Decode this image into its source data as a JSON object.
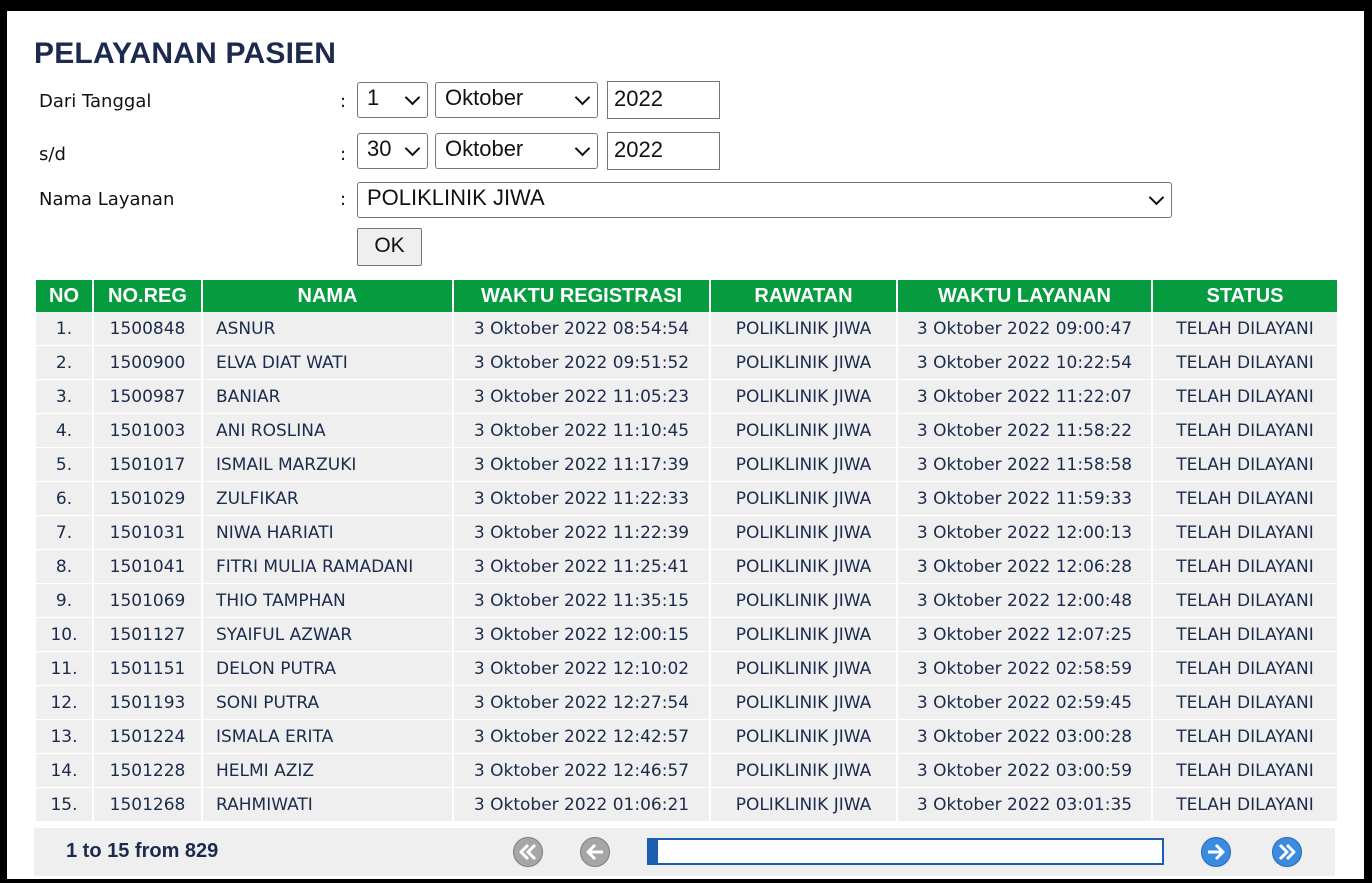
{
  "page": {
    "title": "PELAYANAN PASIEN"
  },
  "filters": {
    "from_label": "Dari Tanggal",
    "to_label": "s/d",
    "service_label": "Nama Layanan",
    "colon": ":",
    "from": {
      "day": "1",
      "month": "Oktober",
      "year": "2022"
    },
    "to": {
      "day": "30",
      "month": "Oktober",
      "year": "2022"
    },
    "service": "POLIKLINIK JIWA",
    "ok_label": "OK"
  },
  "table": {
    "columns": [
      "NO",
      "NO.REG",
      "NAMA",
      "WAKTU REGISTRASI",
      "RAWATAN",
      "WAKTU LAYANAN",
      "STATUS"
    ],
    "rows": [
      [
        "1.",
        "1500848",
        "ASNUR",
        "3 Oktober 2022 08:54:54",
        "POLIKLINIK JIWA",
        "3 Oktober 2022 09:00:47",
        "TELAH DILAYANI"
      ],
      [
        "2.",
        "1500900",
        "ELVA DIAT WATI",
        "3 Oktober 2022 09:51:52",
        "POLIKLINIK JIWA",
        "3 Oktober 2022 10:22:54",
        "TELAH DILAYANI"
      ],
      [
        "3.",
        "1500987",
        "BANIAR",
        "3 Oktober 2022 11:05:23",
        "POLIKLINIK JIWA",
        "3 Oktober 2022 11:22:07",
        "TELAH DILAYANI"
      ],
      [
        "4.",
        "1501003",
        "ANI ROSLINA",
        "3 Oktober 2022 11:10:45",
        "POLIKLINIK JIWA",
        "3 Oktober 2022 11:58:22",
        "TELAH DILAYANI"
      ],
      [
        "5.",
        "1501017",
        "ISMAIL MARZUKI",
        "3 Oktober 2022 11:17:39",
        "POLIKLINIK JIWA",
        "3 Oktober 2022 11:58:58",
        "TELAH DILAYANI"
      ],
      [
        "6.",
        "1501029",
        "ZULFIKAR",
        "3 Oktober 2022 11:22:33",
        "POLIKLINIK JIWA",
        "3 Oktober 2022 11:59:33",
        "TELAH DILAYANI"
      ],
      [
        "7.",
        "1501031",
        "NIWA HARIATI",
        "3 Oktober 2022 11:22:39",
        "POLIKLINIK JIWA",
        "3 Oktober 2022 12:00:13",
        "TELAH DILAYANI"
      ],
      [
        "8.",
        "1501041",
        "FITRI MULIA RAMADANI",
        "3 Oktober 2022 11:25:41",
        "POLIKLINIK JIWA",
        "3 Oktober 2022 12:06:28",
        "TELAH DILAYANI"
      ],
      [
        "9.",
        "1501069",
        "THIO TAMPHAN",
        "3 Oktober 2022 11:35:15",
        "POLIKLINIK JIWA",
        "3 Oktober 2022 12:00:48",
        "TELAH DILAYANI"
      ],
      [
        "10.",
        "1501127",
        "SYAIFUL AZWAR",
        "3 Oktober 2022 12:00:15",
        "POLIKLINIK JIWA",
        "3 Oktober 2022 12:07:25",
        "TELAH DILAYANI"
      ],
      [
        "11.",
        "1501151",
        "DELON PUTRA",
        "3 Oktober 2022 12:10:02",
        "POLIKLINIK JIWA",
        "3 Oktober 2022 02:58:59",
        "TELAH DILAYANI"
      ],
      [
        "12.",
        "1501193",
        "SONI PUTRA",
        "3 Oktober 2022 12:27:54",
        "POLIKLINIK JIWA",
        "3 Oktober 2022 02:59:45",
        "TELAH DILAYANI"
      ],
      [
        "13.",
        "1501224",
        "ISMALA ERITA",
        "3 Oktober 2022 12:42:57",
        "POLIKLINIK JIWA",
        "3 Oktober 2022 03:00:28",
        "TELAH DILAYANI"
      ],
      [
        "14.",
        "1501228",
        "HELMI AZIZ",
        "3 Oktober 2022 12:46:57",
        "POLIKLINIK JIWA",
        "3 Oktober 2022 03:00:59",
        "TELAH DILAYANI"
      ],
      [
        "15.",
        "1501268",
        "RAHMIWATI",
        "3 Oktober 2022 01:06:21",
        "POLIKLINIK JIWA",
        "3 Oktober 2022 03:01:35",
        "TELAH DILAYANI"
      ]
    ]
  },
  "pagination": {
    "summary": "1 to 15 from 829",
    "progress": 0.018,
    "icons": {
      "first": "double-chevron-left-icon",
      "prev": "arrow-left-icon",
      "next": "arrow-right-icon",
      "last": "double-chevron-right-icon"
    }
  },
  "colors": {
    "header_green": "#079b3f",
    "row_gray": "#efefef",
    "nav_blue": "#2f7fd8",
    "nav_gray": "#9a9a9a",
    "title_navy": "#1b2a4e"
  }
}
